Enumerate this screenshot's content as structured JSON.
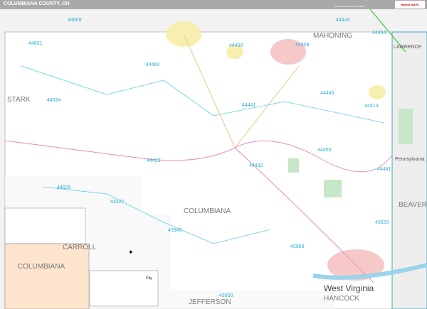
{
  "header": {
    "title": "COLUMBIANA COUNTY, OH",
    "edition": "2026 ZIP Code Premium Edition",
    "logo": "Market MAPS"
  },
  "counties": {
    "mahoning": "MAHONING",
    "lawrence": "LAWRENCE",
    "stark": "STARK",
    "pennsylvania": "Pennsylvania",
    "beaver": "BEAVER",
    "columbiana": "COLUMBIANA",
    "carroll": "CARROLL",
    "jefferson": "JEFFERSON",
    "west_virginia": "West Virginia",
    "hancock": "HANCOCK",
    "inset": "COLUMBIANA"
  },
  "zips": [
    "44609",
    "44601",
    "44460",
    "44490",
    "44408",
    "44443",
    "44454",
    "44634",
    "44445",
    "44413",
    "44441",
    "44432",
    "44455",
    "44423",
    "44441",
    "44625",
    "44427",
    "43945",
    "43920",
    "43968",
    "43930"
  ],
  "legend": {
    "city": "City"
  }
}
